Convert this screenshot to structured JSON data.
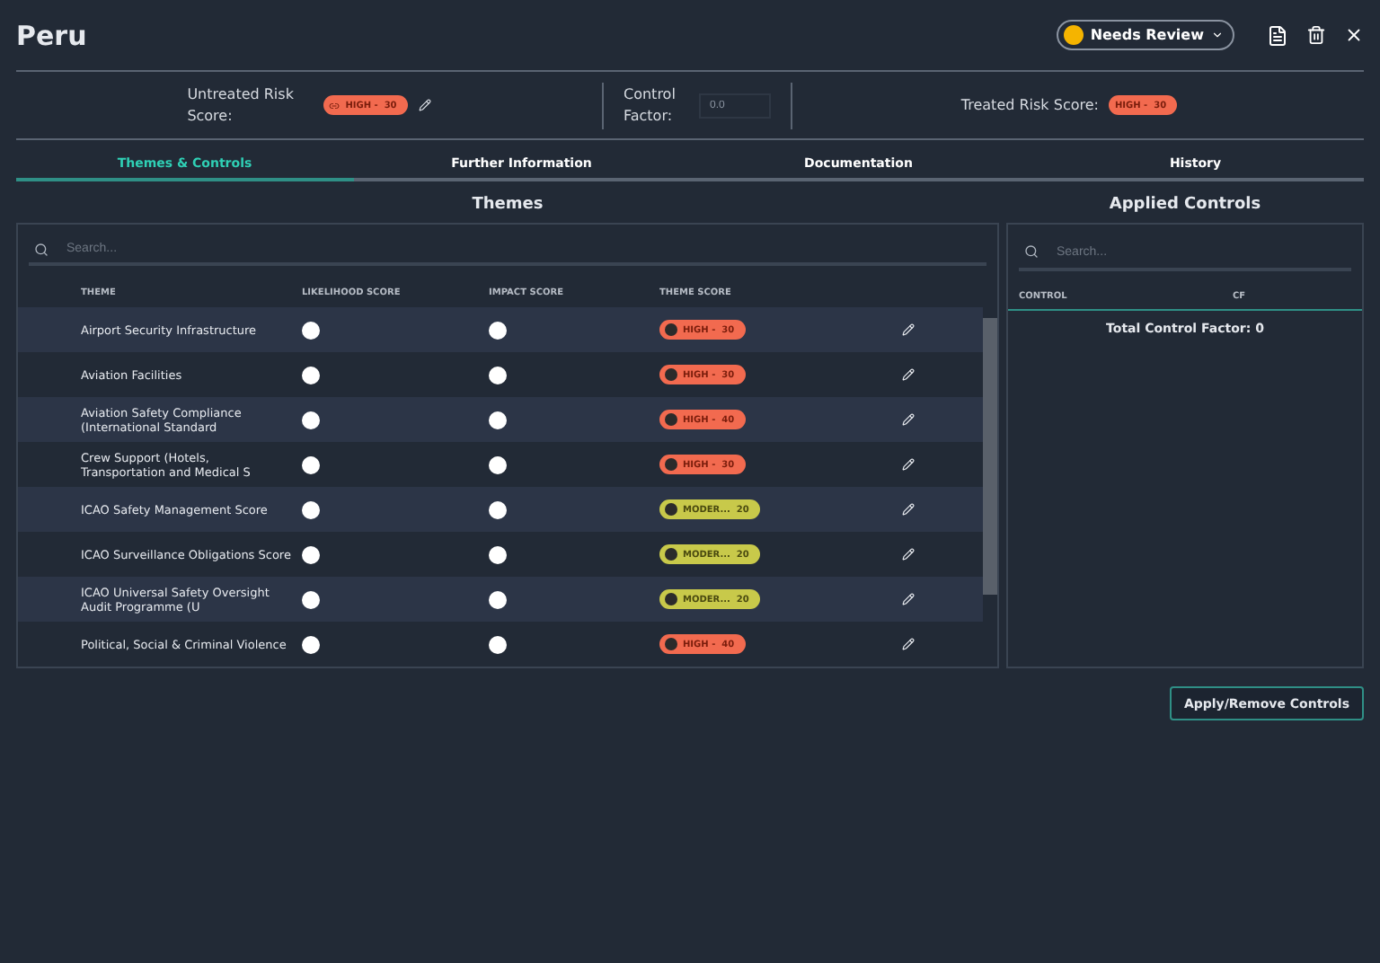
{
  "title": "Peru",
  "status": {
    "label": "Needs Review"
  },
  "untreated": {
    "label": "Untreated Risk Score:",
    "badge": {
      "kind": "high",
      "text": "HIGH -",
      "score": "30"
    }
  },
  "control_factor": {
    "label": "Control Factor",
    "suffix": ":",
    "value": "0.0"
  },
  "treated": {
    "label": "Treated Risk Score:",
    "badge": {
      "kind": "high",
      "text": "HIGH -",
      "score": "30"
    }
  },
  "tabs": [
    {
      "label": "Themes & Controls",
      "selected": true
    },
    {
      "label": "Further Information",
      "selected": false
    },
    {
      "label": "Documentation",
      "selected": false
    },
    {
      "label": "History",
      "selected": false
    }
  ],
  "themes": {
    "title": "Themes",
    "search": {
      "placeholder": "Search..."
    },
    "columns": [
      "THEME",
      "LIKELIHOOD SCORE",
      "IMPACT SCORE",
      "THEME SCORE"
    ],
    "rows": [
      {
        "theme": "Airport Security Infrastructure",
        "badge": {
          "kind": "high",
          "text": "HIGH -",
          "score": "30"
        }
      },
      {
        "theme": "Aviation Facilities",
        "badge": {
          "kind": "high",
          "text": "HIGH -",
          "score": "30"
        }
      },
      {
        "theme": "Aviation Safety Compliance (International Standard",
        "badge": {
          "kind": "high",
          "text": "HIGH -",
          "score": "40"
        }
      },
      {
        "theme": "Crew Support (Hotels, Transportation and Medical S",
        "badge": {
          "kind": "high",
          "text": "HIGH -",
          "score": "30"
        }
      },
      {
        "theme": "ICAO Safety Management Score",
        "badge": {
          "kind": "moderate",
          "text": "MODER...",
          "score": "20"
        }
      },
      {
        "theme": "ICAO Surveillance Obligations Score",
        "badge": {
          "kind": "moderate",
          "text": "MODER...",
          "score": "20"
        }
      },
      {
        "theme": "ICAO Universal Safety Oversight Audit Programme (U",
        "badge": {
          "kind": "moderate",
          "text": "MODER...",
          "score": "20"
        }
      },
      {
        "theme": "Political, Social & Criminal Violence",
        "badge": {
          "kind": "high",
          "text": "HIGH -",
          "score": "40"
        }
      }
    ]
  },
  "controls": {
    "title": "Applied Controls",
    "search": {
      "placeholder": "Search..."
    },
    "columns": [
      "CONTROL",
      "CF"
    ],
    "total_label": "Total Control Factor:",
    "total_value": "0"
  },
  "apply_button": "Apply/Remove Controls"
}
